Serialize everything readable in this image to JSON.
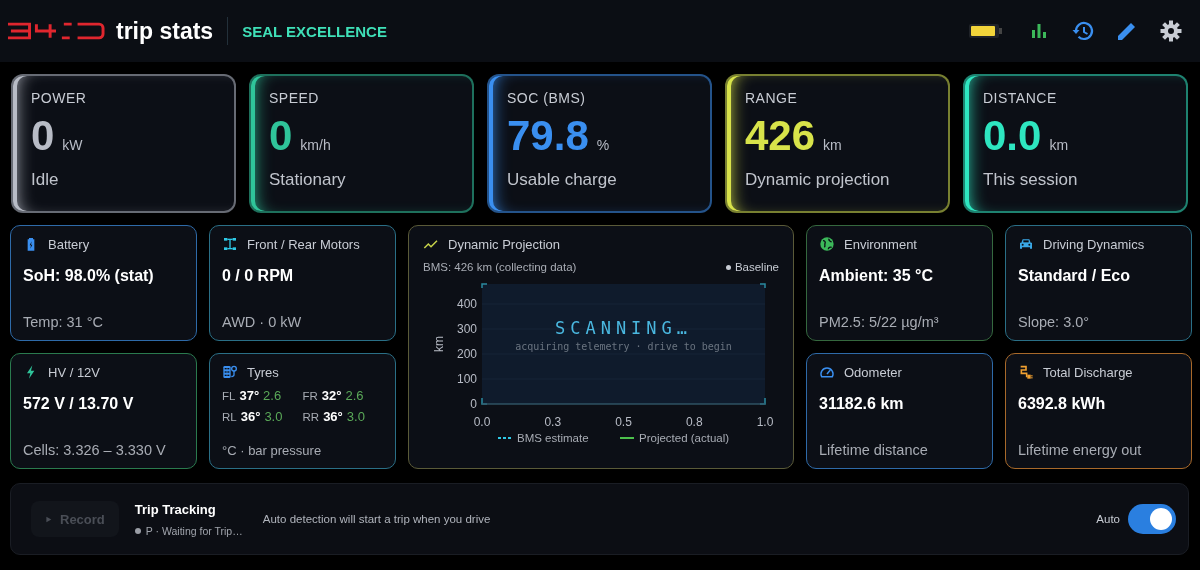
{
  "header": {
    "brand": "trip stats",
    "model": "SEAL EXCELLENCE"
  },
  "stats": [
    {
      "label": "POWER",
      "value": "0",
      "unit": "kW",
      "caption": "Idle",
      "color": "#b8bcc6"
    },
    {
      "label": "SPEED",
      "value": "0",
      "unit": "km/h",
      "caption": "Stationary",
      "color": "#2fc49a"
    },
    {
      "label": "SOC (BMS)",
      "value": "79.8",
      "unit": "%",
      "caption": "Usable charge",
      "color": "#3a8ff0"
    },
    {
      "label": "RANGE",
      "value": "426",
      "unit": "km",
      "caption": "Dynamic projection",
      "color": "#d8e34a"
    },
    {
      "label": "DISTANCE",
      "value": "0.0",
      "unit": "km",
      "caption": "This session",
      "color": "#2ee6c0"
    }
  ],
  "left_tiles": [
    {
      "kind": "metric",
      "title": "Battery",
      "value": "SoH: 98.0% (stat)",
      "caption": "Temp: 31 °C",
      "color": "#2e6aa8"
    },
    {
      "kind": "metric",
      "title": "Front / Rear Motors",
      "value": "0 / 0 RPM",
      "caption": "AWD · 0 kW",
      "color": "#2a6f86"
    },
    {
      "kind": "metric",
      "title": "HV / 12V",
      "value": "572 V / 13.70 V",
      "caption": "Cells: 3.326 – 3.330 V",
      "color": "#2a7a4e"
    },
    {
      "kind": "tyres",
      "title": "Tyres",
      "tyres": [
        {
          "pos": "FL",
          "temp": "37°",
          "pressure": "2.6"
        },
        {
          "pos": "FR",
          "temp": "32°",
          "pressure": "2.6"
        },
        {
          "pos": "RL",
          "temp": "36°",
          "pressure": "3.0"
        },
        {
          "pos": "RR",
          "temp": "36°",
          "pressure": "3.0"
        }
      ],
      "caption": "°C · bar pressure",
      "color": "#2a6f86"
    }
  ],
  "projection": {
    "title": "Dynamic Projection",
    "subtitle": "BMS: 426 km (collecting data)",
    "badge": "Baseline",
    "overlay_title": "SCANNING…",
    "overlay_text": "acquiring telemetry · drive to begin",
    "chart_data": {
      "type": "line",
      "ylabel": "km",
      "categories": [
        "0.0",
        "0.3",
        "0.5",
        "0.8",
        "1.0"
      ],
      "ylim": [
        0,
        480
      ],
      "yticks": [
        0,
        100,
        200,
        300,
        400
      ],
      "series": [
        {
          "name": "BMS estimate",
          "color": "#2ec8e6",
          "values": [
            null,
            null,
            null,
            null,
            null
          ]
        },
        {
          "name": "Projected (actual)",
          "color": "#4cc04c",
          "values": [
            null,
            null,
            null,
            null,
            null
          ]
        }
      ]
    }
  },
  "right_tiles": [
    {
      "kind": "metric",
      "title": "Environment",
      "value": "Ambient: 35 °C",
      "caption": "PM2.5: 5/22 µg/m³",
      "color": "#35683e"
    },
    {
      "kind": "metric",
      "title": "Driving Dynamics",
      "value": "Standard / Eco",
      "caption": "Slope: 3.0°",
      "color": "#2a6f86"
    },
    {
      "kind": "metric",
      "title": "Odometer",
      "value": "31182.6 km",
      "caption": "Lifetime distance",
      "color": "#2e6aa8"
    },
    {
      "kind": "metric",
      "title": "Total Discharge",
      "value": "6392.8 kWh",
      "caption": "Lifetime energy out",
      "color": "#a8692a"
    }
  ],
  "trip": {
    "record": "Record",
    "record_disabled": true,
    "title": "Trip Tracking",
    "status": "P · Waiting for Trip…",
    "message": "Auto detection will start a trip when you drive",
    "auto_label": "Auto",
    "auto_on": true
  }
}
